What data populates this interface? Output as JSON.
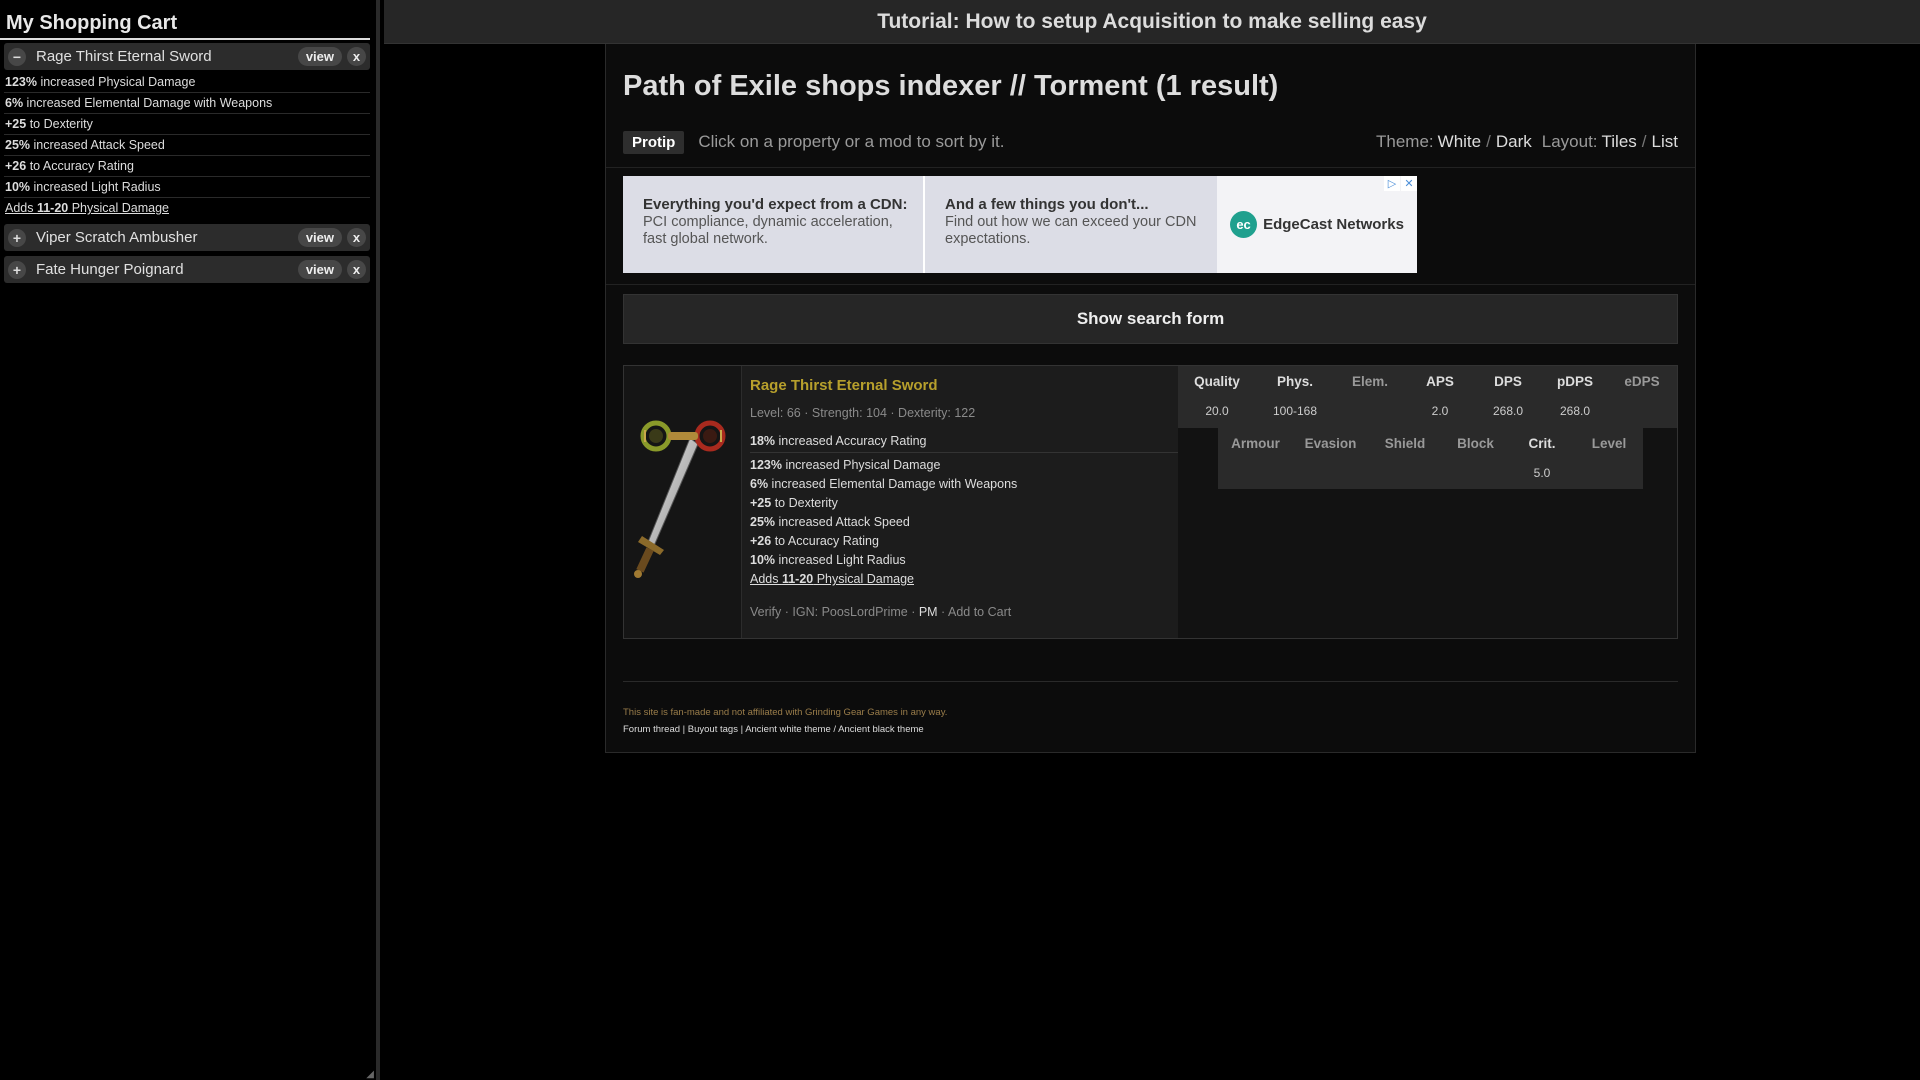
{
  "sidebar": {
    "title": "My Shopping Cart",
    "items": [
      {
        "toggle": "−",
        "name": "Rage Thirst Eternal Sword",
        "view_label": "view",
        "remove_label": "x",
        "mods": [
          {
            "value": "123%",
            "text": " increased Physical Damage"
          },
          {
            "value": "6%",
            "text": " increased Elemental Damage with Weapons"
          },
          {
            "value": "+25",
            "text": " to Dexterity"
          },
          {
            "value": "25%",
            "text": " increased Attack Speed"
          },
          {
            "value": "+26",
            "text": " to Accuracy Rating"
          },
          {
            "value": "10%",
            "text": " increased Light Radius"
          }
        ],
        "link_mod": {
          "pre": "Adds ",
          "value": "11-20",
          "post": " Physical Damage"
        }
      },
      {
        "toggle": "+",
        "name": "Viper Scratch Ambusher",
        "view_label": "view",
        "remove_label": "x"
      },
      {
        "toggle": "+",
        "name": "Fate Hunger Poignard",
        "view_label": "view",
        "remove_label": "x"
      }
    ]
  },
  "topbar": {
    "title": "Tutorial: How to setup Acquisition to make selling easy"
  },
  "main": {
    "title": "Path of Exile shops indexer // Torment (1 result)",
    "protip_label": "Protip",
    "protip_text": "Click on a property or a mod to sort by it.",
    "theme_label": "Theme:",
    "theme_white": "White",
    "theme_dark": "Dark",
    "layout_label": "Layout:",
    "layout_tiles": "Tiles",
    "layout_list": "List",
    "slash": "/",
    "search_button": "Show search form"
  },
  "ad": {
    "col1_title": "Everything you'd expect from a CDN:",
    "col1_text": "PCI compliance, dynamic acceleration, fast global network.",
    "col2_title": "And a few things you don't...",
    "col2_text": "Find out how we can exceed your CDN expectations.",
    "logo": "ec",
    "brand": "EdgeCast Networks",
    "ad_choices": "▷",
    "close": "✕"
  },
  "item": {
    "name": "Rage Thirst Eternal Sword",
    "req_level_label": "Level:",
    "req_level": "66",
    "req_str_label": "Strength:",
    "req_str": "104",
    "req_dex_label": "Dexterity:",
    "req_dex": "122",
    "sep": " · ",
    "implicit": {
      "value": "18%",
      "text": " increased Accuracy Rating"
    },
    "mods": [
      {
        "value": "123%",
        "text": " increased Physical Damage"
      },
      {
        "value": "6%",
        "text": " increased Elemental Damage with Weapons"
      },
      {
        "value": "+25",
        "text": " to Dexterity"
      },
      {
        "value": "25%",
        "text": " increased Attack Speed"
      },
      {
        "value": "+26",
        "text": " to Accuracy Rating"
      },
      {
        "value": "10%",
        "text": " increased Light Radius"
      }
    ],
    "link_mod": {
      "pre": "Adds ",
      "value": "11-20",
      "post": " Physical Damage"
    },
    "actions": {
      "verify": "Verify",
      "ign_label": "IGN:",
      "ign": "PoosLordPrime",
      "pm": "PM",
      "add_to_cart": "Add to Cart"
    }
  },
  "stats": {
    "headers1": [
      "Quality",
      "Phys.",
      "Elem.",
      "APS",
      "DPS",
      "pDPS",
      "eDPS"
    ],
    "values1": [
      "20.0",
      "100-168",
      "",
      "2.0",
      "268.0",
      "268.0",
      ""
    ],
    "headers2": [
      "Armour",
      "Evasion",
      "Shield",
      "Block",
      "Crit.",
      "Level"
    ],
    "values2": [
      "",
      "",
      "",
      "",
      "5.0",
      ""
    ]
  },
  "footer": {
    "note": "This site is fan-made and not affiliated with Grinding Gear Games in any way.",
    "forum": "Forum thread",
    "buyout": "Buyout tags",
    "ancient_white": "Ancient white theme",
    "ancient_black": "Ancient black theme",
    "pipe": " | ",
    "slash": " / "
  }
}
